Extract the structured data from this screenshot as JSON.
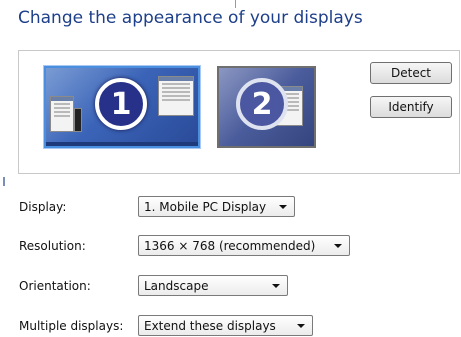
{
  "header": {
    "title": "Change the appearance of your displays"
  },
  "monitors": [
    {
      "number": "1",
      "selected": true
    },
    {
      "number": "2",
      "selected": false
    }
  ],
  "buttons": {
    "detect": "Detect",
    "identify": "Identify"
  },
  "settings": {
    "display": {
      "label": "Display:",
      "value": "1. Mobile PC Display"
    },
    "resolution": {
      "label": "Resolution:",
      "value": "1366 × 768 (recommended)"
    },
    "orientation": {
      "label": "Orientation:",
      "value": "Landscape"
    },
    "multiple_displays": {
      "label": "Multiple displays:",
      "value": "Extend these displays"
    }
  },
  "colors": {
    "title": "#1e3f8a",
    "selected_monitor_border": "#4a8ee0",
    "monitor_bg": "#3b64b8"
  }
}
